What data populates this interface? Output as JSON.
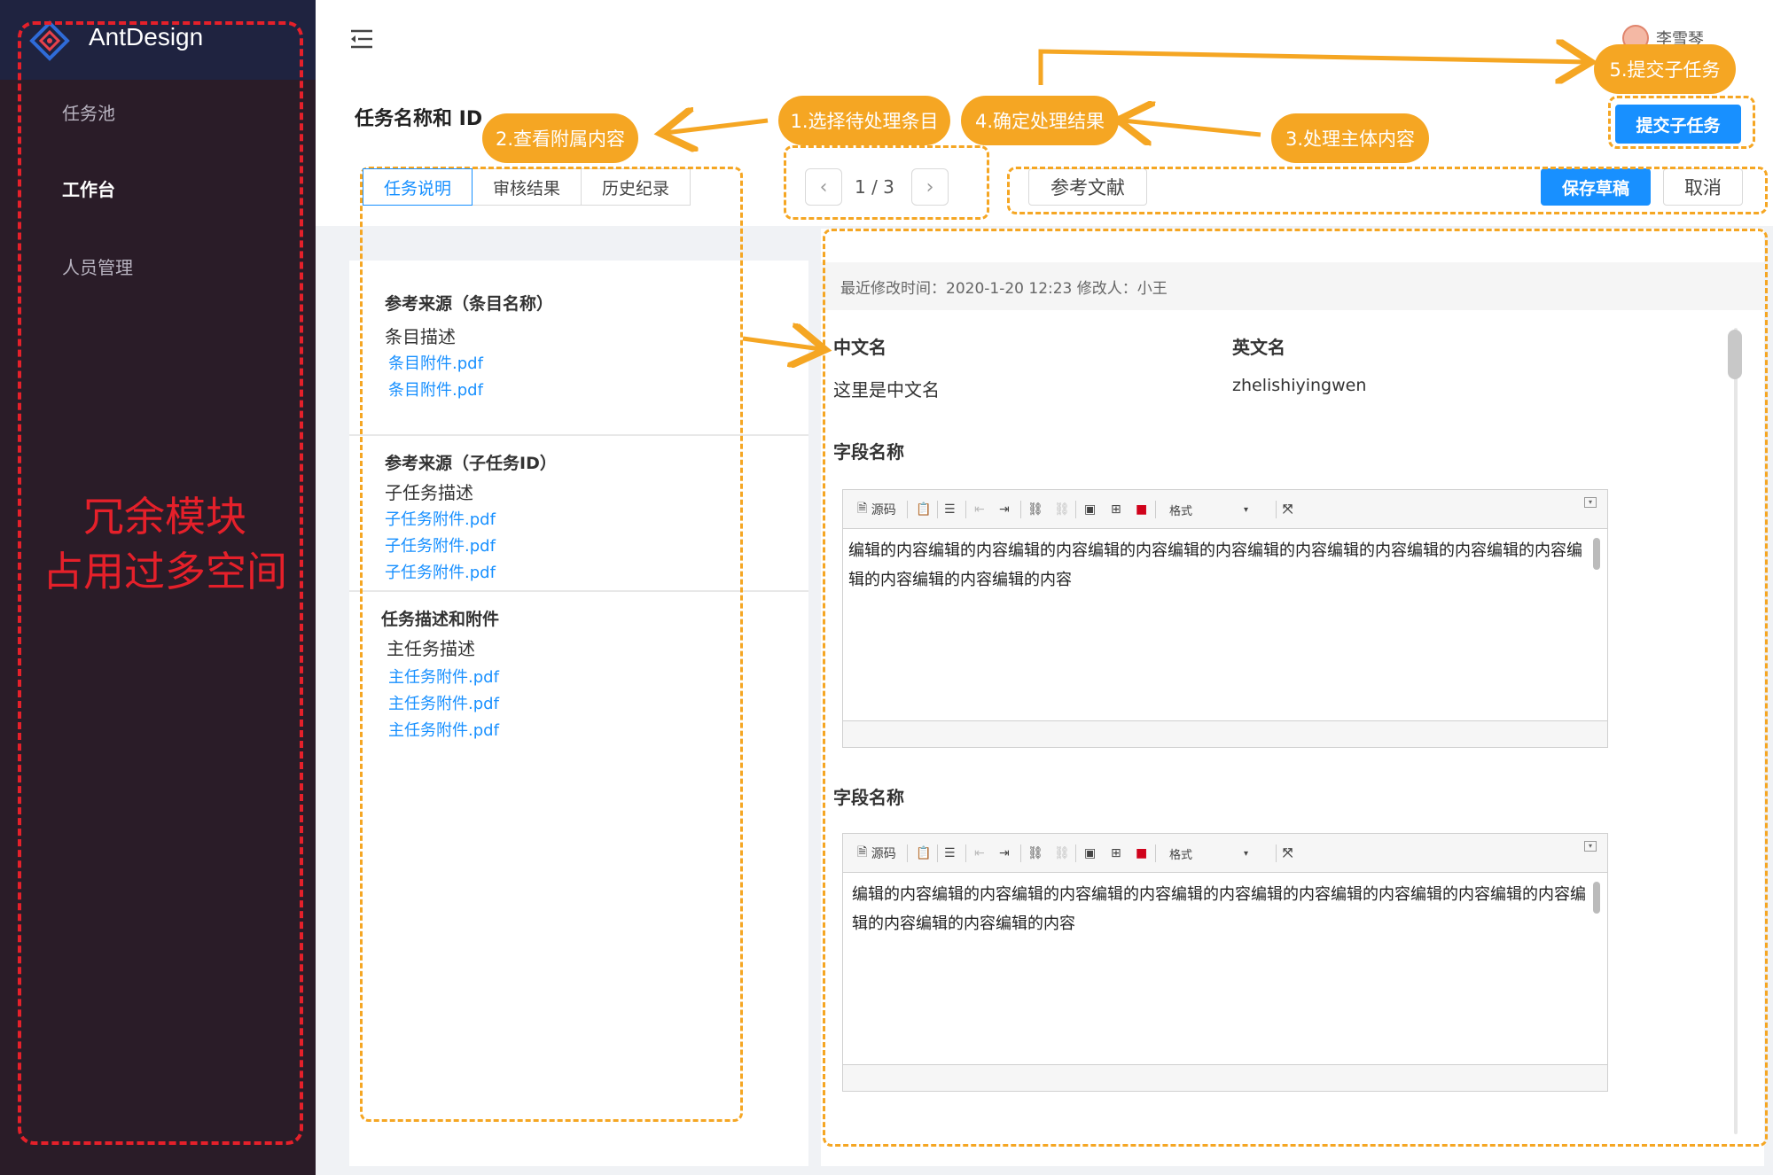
{
  "brand": {
    "name": "AntDesign"
  },
  "sidebar": {
    "items": [
      {
        "label": "任务池"
      },
      {
        "label": "工作台"
      },
      {
        "label": "人员管理"
      }
    ],
    "annotation": {
      "line1": "冗余模块",
      "line2": "占用过多空间"
    }
  },
  "header": {
    "username": "李雪琴"
  },
  "page": {
    "title": "任务名称和 ID"
  },
  "tabs": [
    {
      "label": "任务说明"
    },
    {
      "label": "审核结果"
    },
    {
      "label": "历史纪录"
    }
  ],
  "pager": {
    "text": "1 / 3"
  },
  "toolbar": {
    "reference_label": "参考文献",
    "save_label": "保存草稿",
    "cancel_label": "取消",
    "submit_label": "提交子任务"
  },
  "references": [
    {
      "title": "参考来源（条目名称）",
      "desc": "条目描述",
      "files": [
        "条目附件.pdf",
        "条目附件.pdf"
      ]
    },
    {
      "title": "参考来源（子任务ID）",
      "desc": "子任务描述",
      "files": [
        "子任务附件.pdf",
        "子任务附件.pdf",
        "子任务附件.pdf"
      ]
    },
    {
      "title": "任务描述和附件",
      "desc": "主任务描述",
      "files": [
        "主任务附件.pdf",
        "主任务附件.pdf",
        "主任务附件.pdf"
      ]
    }
  ],
  "detail": {
    "meta": "最近修改时间：2020-1-20 12:23    修改人：小王",
    "cn_label": "中文名",
    "cn_value": "这里是中文名",
    "en_label": "英文名",
    "en_value": "zhelishiyingwen",
    "fields": [
      {
        "label": "字段名称",
        "content": "编辑的内容编辑的内容编辑的内容编辑的内容编辑的内容编辑的内容编辑的内容编辑的内容编辑的内容编辑的内容编辑的内容编辑的内容"
      },
      {
        "label": "字段名称",
        "content": "编辑的内容编辑的内容编辑的内容编辑的内容编辑的内容编辑的内容编辑的内容编辑的内容编辑的内容编辑的内容编辑的内容编辑的内容"
      }
    ],
    "editor_toolbar": {
      "source": "源码",
      "format": "格式"
    }
  },
  "annotations": {
    "step1": "1.选择待处理条目",
    "step2": "2.查看附属内容",
    "step3": "3.处理主体内容",
    "step4": "4.确定处理结果",
    "step5": "5.提交子任务"
  },
  "colors": {
    "annotation": "#f5a623",
    "warning": "#e5202a",
    "primary": "#1890ff",
    "sidebar": "#2a1c28"
  }
}
